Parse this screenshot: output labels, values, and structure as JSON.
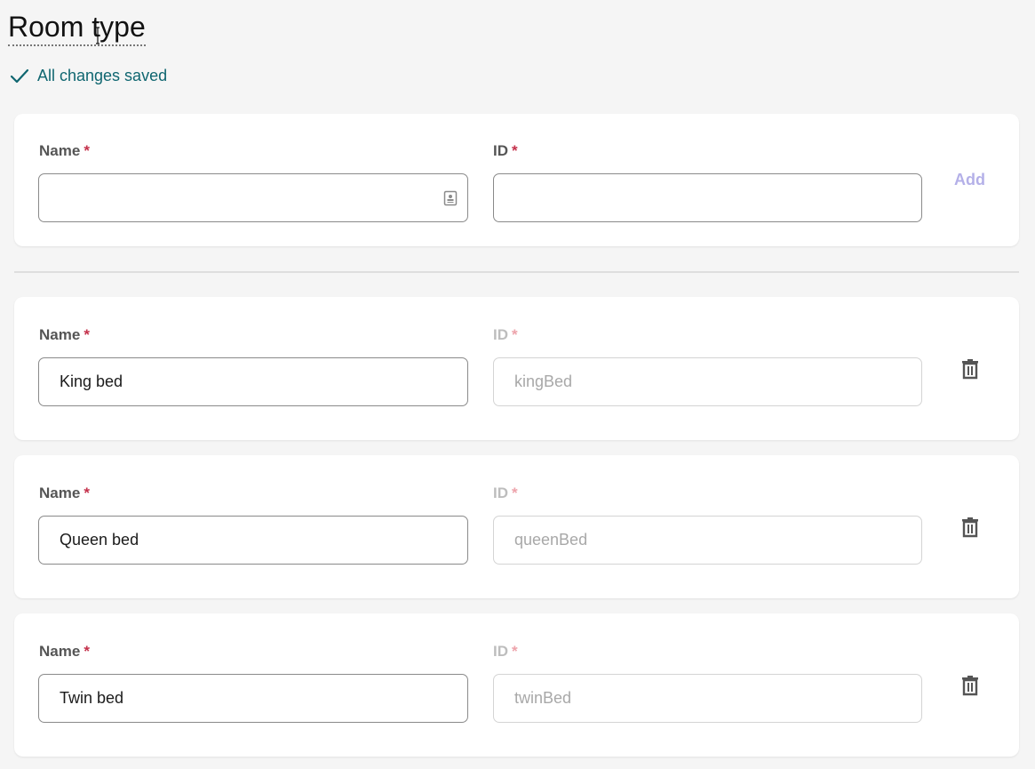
{
  "header": {
    "title": "Room type",
    "status": "All changes saved"
  },
  "colors": {
    "status": "#0f6670",
    "required": "#c4314b",
    "add_disabled": "#b4b0e8"
  },
  "new_item": {
    "name_label": "Name",
    "id_label": "ID",
    "required_mark": "*",
    "name_value": "",
    "id_value": "",
    "add_label": "Add"
  },
  "items": [
    {
      "name_label": "Name",
      "id_label": "ID",
      "required_mark": "*",
      "name": "King bed",
      "id": "kingBed"
    },
    {
      "name_label": "Name",
      "id_label": "ID",
      "required_mark": "*",
      "name": "Queen bed",
      "id": "queenBed"
    },
    {
      "name_label": "Name",
      "id_label": "ID",
      "required_mark": "*",
      "name": "Twin bed",
      "id": "twinBed"
    }
  ]
}
